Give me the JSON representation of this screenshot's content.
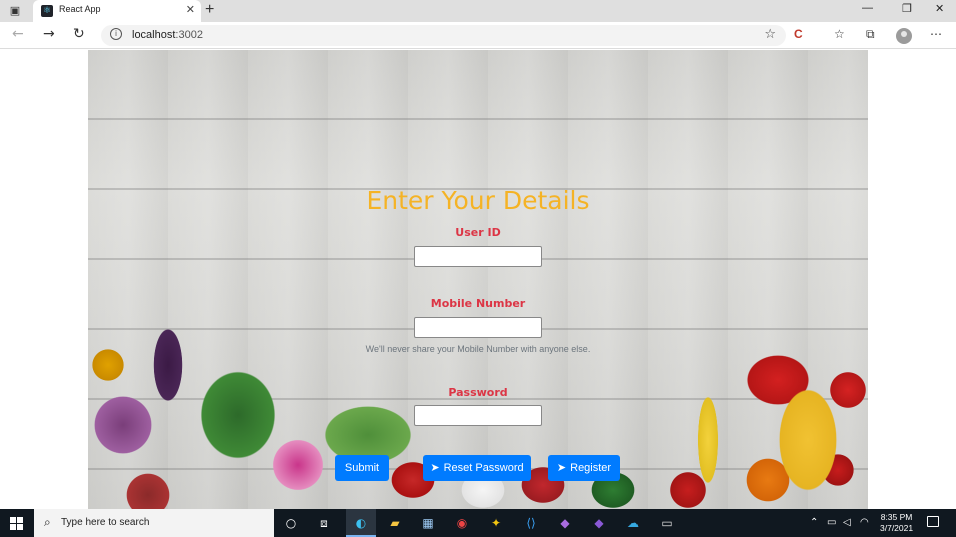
{
  "browser": {
    "tab_title": "React App",
    "tab_close": "✕",
    "new_tab": "+",
    "url_host": "localhost",
    "url_port": ":3002",
    "window_controls": {
      "minimize": "—",
      "restore": "❐",
      "close": "✕"
    }
  },
  "page": {
    "title": "Enter Your Details",
    "fields": {
      "user_id": {
        "label": "User ID",
        "value": ""
      },
      "mobile": {
        "label": "Mobile Number",
        "value": ""
      },
      "password": {
        "label": "Password",
        "value": ""
      }
    },
    "mobile_help": "We'll never share your Mobile Number with anyone else.",
    "buttons": {
      "submit": "Submit",
      "reset": "Reset Password",
      "register": "Register"
    }
  },
  "taskbar": {
    "search_placeholder": "Type here to search",
    "time": "8:35 PM",
    "date": "3/7/2021"
  },
  "icons": {
    "favicon": "react-icon",
    "send": "paper-plane-icon",
    "info": "info-icon"
  }
}
